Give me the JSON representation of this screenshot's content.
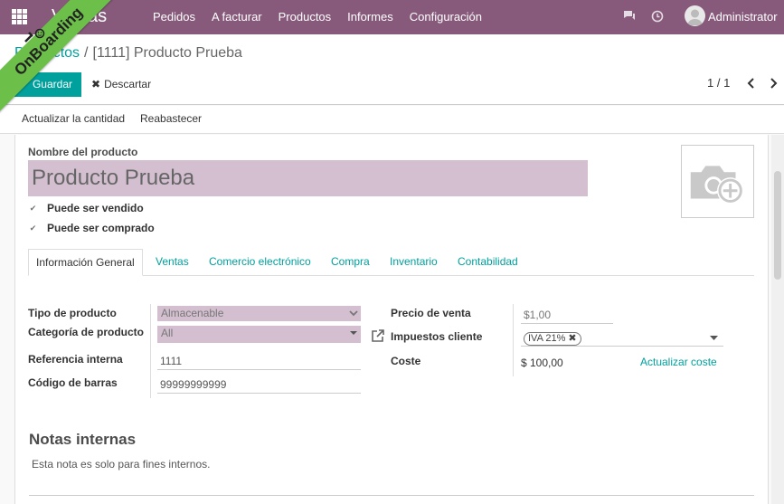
{
  "navbar": {
    "app_name": "Ventas",
    "menu": [
      "Pedidos",
      "A facturar",
      "Productos",
      "Informes",
      "Configuración"
    ],
    "user": "Administrator"
  },
  "breadcrumb": {
    "parent": "Productos",
    "separator": "/",
    "current": "[1111] Producto Prueba"
  },
  "toolbar": {
    "save_label": "Guardar",
    "discard_label": "Descartar",
    "discard_icon": "✖",
    "pager": "1 / 1"
  },
  "actions": {
    "update_qty": "Actualizar la cantidad",
    "replenish": "Reabastecer"
  },
  "product": {
    "name_label": "Nombre del producto",
    "name": "Producto Prueba",
    "can_be_sold": "Puede ser vendido",
    "can_be_purchased": "Puede ser comprado"
  },
  "tabs": [
    "Información General",
    "Ventas",
    "Comercio electrónico",
    "Compra",
    "Inventario",
    "Contabilidad"
  ],
  "general": {
    "type_label": "Tipo de producto",
    "type_value": "Almacenable",
    "category_label": "Categoría de producto",
    "category_value": "All",
    "ref_label": "Referencia interna",
    "ref_value": "1111",
    "barcode_label": "Código de barras",
    "barcode_value": "99999999999",
    "price_label": "Precio de venta",
    "price_value": "$1,00",
    "taxes_label": "Impuestos cliente",
    "tax_tag": "IVA 21%",
    "tax_remove": "✖",
    "cost_label": "Coste",
    "cost_value": "$ 100,00",
    "update_cost": "Actualizar coste"
  },
  "notes": {
    "title": "Notas internas",
    "text": "Esta nota es solo para fines internos."
  },
  "onboarding": {
    "label": "OnBoarding"
  },
  "colors": {
    "navbar": "#875a7b",
    "accent": "#00a09d",
    "input_bg": "#d3bfd0",
    "ribbon": "#6cc04a"
  }
}
